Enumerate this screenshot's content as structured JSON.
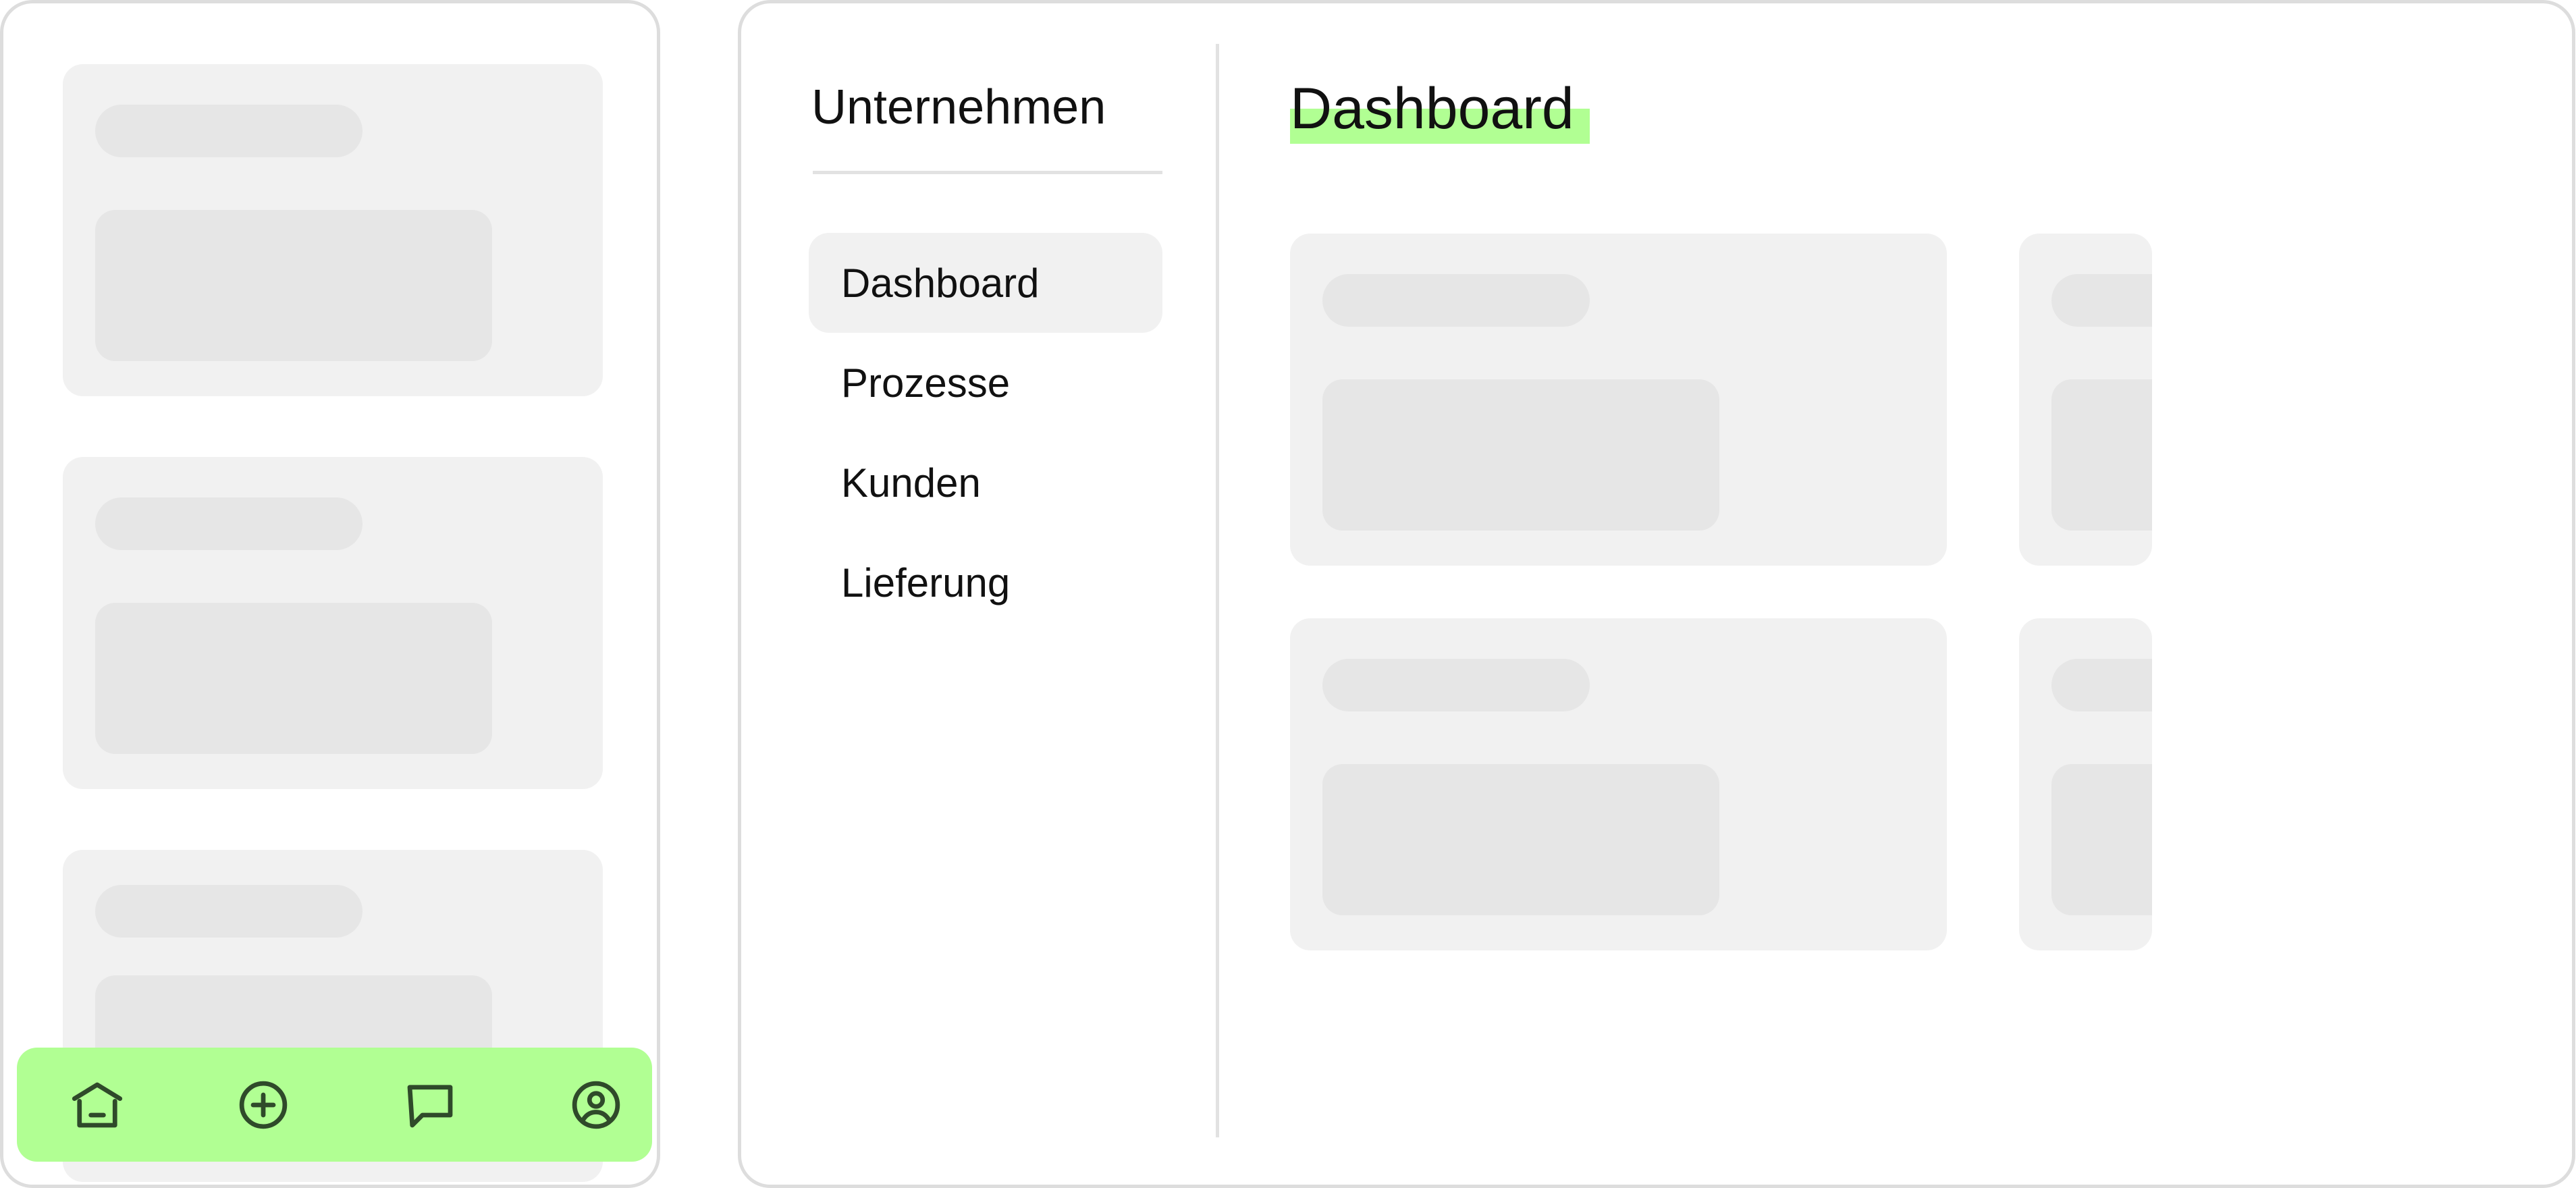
{
  "mobile": {
    "bottom_nav": {
      "background": "#b1ff93",
      "icon_color": "#2f4a2a",
      "items": [
        {
          "icon": "home-icon"
        },
        {
          "icon": "plus-circle-icon"
        },
        {
          "icon": "message-icon"
        },
        {
          "icon": "user-circle-icon"
        }
      ]
    }
  },
  "desktop": {
    "sidebar": {
      "title": "Unternehmen",
      "items": [
        {
          "label": "Dashboard",
          "active": true
        },
        {
          "label": "Prozesse",
          "active": false
        },
        {
          "label": "Kunden",
          "active": false
        },
        {
          "label": "Lieferung",
          "active": false
        }
      ]
    },
    "page_title": "Dashboard",
    "highlight_color": "#b1ff93"
  },
  "colors": {
    "frame_border": "#dddddd",
    "card_bg": "#f1f1f1",
    "skeleton": "#e6e6e6",
    "active_nav_bg": "#f1f1f1",
    "accent": "#b1ff93"
  }
}
